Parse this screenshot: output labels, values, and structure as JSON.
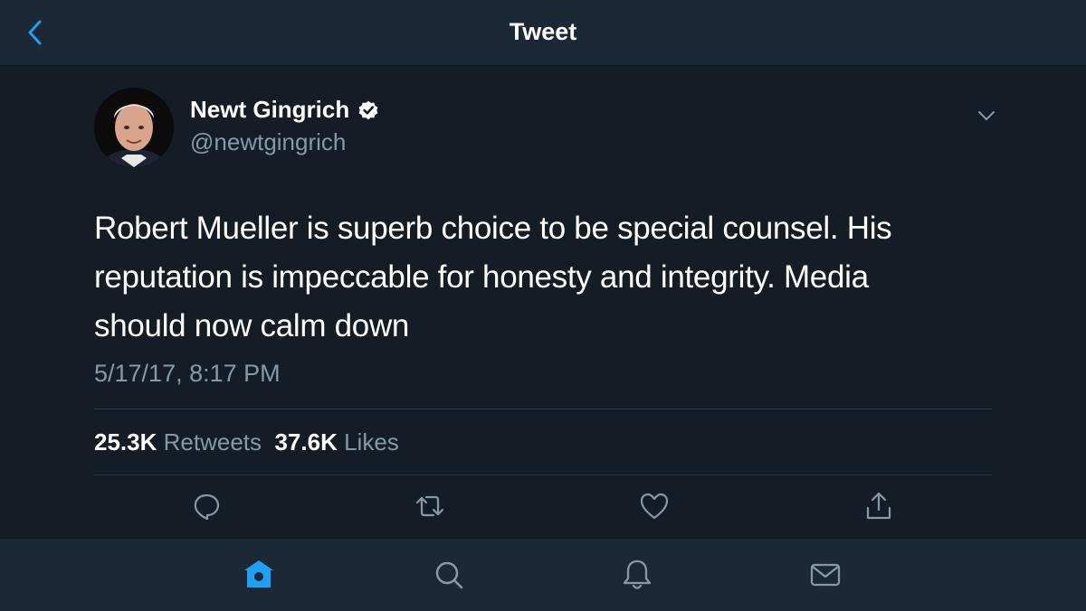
{
  "header": {
    "title": "Tweet",
    "back_icon": "chevron-left-icon"
  },
  "tweet": {
    "author_name": "Newt Gingrich",
    "author_handle": "@newtgingrich",
    "verified_icon": "verified-badge-icon",
    "text": "Robert Mueller is superb choice to be special counsel. His reputation is impeccable for honesty and integrity. Media should now calm down",
    "timestamp": "5/17/17, 8:17 PM",
    "retweets_count": "25.3K",
    "retweets_label": "Retweets",
    "likes_count": "37.6K",
    "likes_label": "Likes"
  },
  "actions": [
    "reply-icon",
    "retweet-icon",
    "like-icon",
    "share-icon"
  ],
  "tabbar": [
    "home-icon",
    "search-icon",
    "notifications-icon",
    "messages-icon"
  ],
  "colors": {
    "background": "#141d26",
    "bar": "#1b2836",
    "accent": "#1da1f2",
    "secondary_text": "#8899a6",
    "divider": "#2a3745"
  }
}
